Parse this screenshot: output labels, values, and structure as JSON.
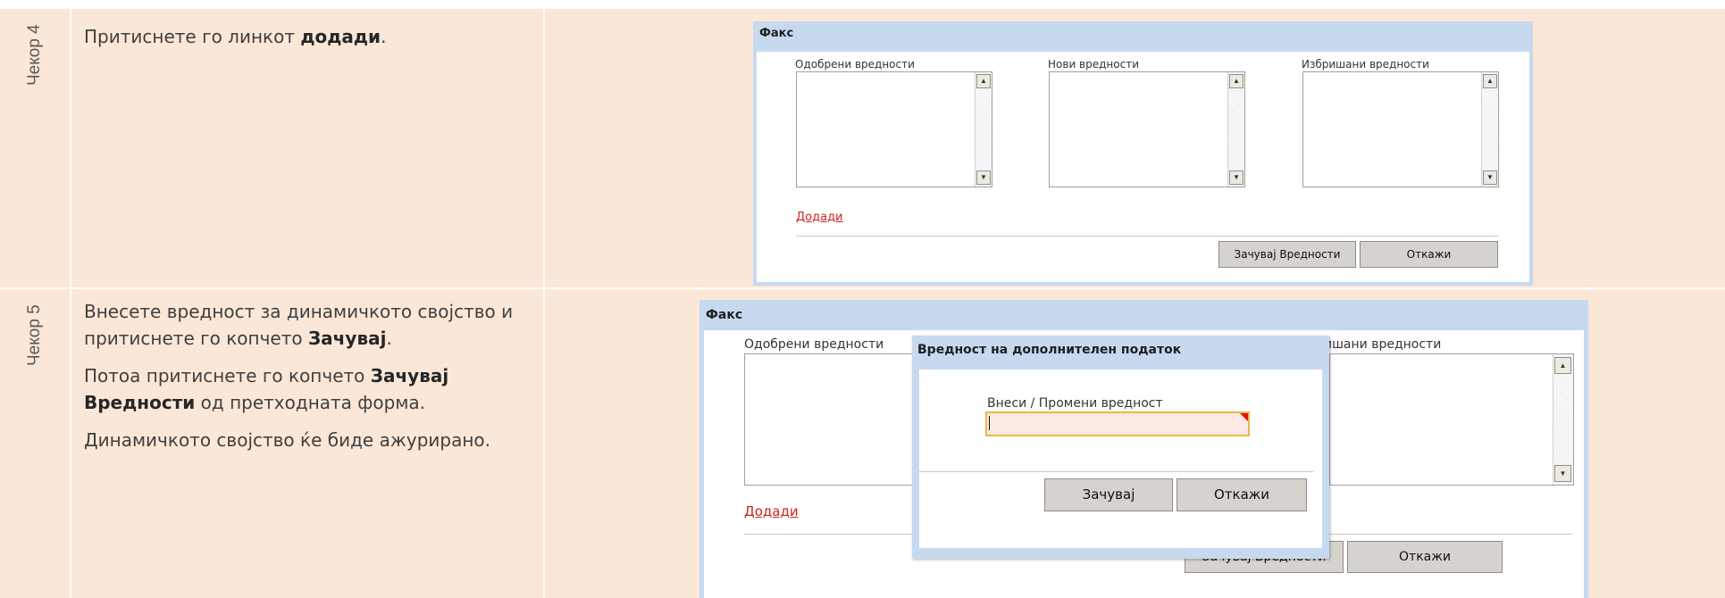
{
  "steps": [
    {
      "label": "Чекор 4",
      "text": {
        "p1_before": "Притиснете го линкот ",
        "p1_bold": "додади",
        "p1_after": "."
      },
      "screenshot": {
        "title": "Факс",
        "col1": "Одобрени вредности",
        "col2": "Нови вредности",
        "col3": "Избришани вредности",
        "add_link": "Додади",
        "save_values": "Зачувај Вредности",
        "cancel": "Откажи"
      }
    },
    {
      "label": "Чекор 5",
      "text": {
        "p1_before": "Внесете вредност за динамичкото својство и притиснете го копчето ",
        "p1_bold": "Зачувај",
        "p1_after": ".",
        "p2_before": "Потоа притиснете го копчето ",
        "p2_bold": "Зачувај Вредности",
        "p2_after": " од претходната форма.",
        "p3": "Динамичкото својство ќе биде ажурирано."
      },
      "screenshot": {
        "title": "Факс",
        "col1": "Одобрени вредности",
        "col3_partial": "ишани вредности",
        "add_link": "Додади",
        "save_values": "Зачувај Вредности",
        "cancel": "Откажи",
        "modal": {
          "title": "Вредност на дополнителен податок",
          "field_label": "Внеси / Промени вредност",
          "field_value": "",
          "save": "Зачувај",
          "cancel": "Откажи"
        }
      }
    }
  ]
}
